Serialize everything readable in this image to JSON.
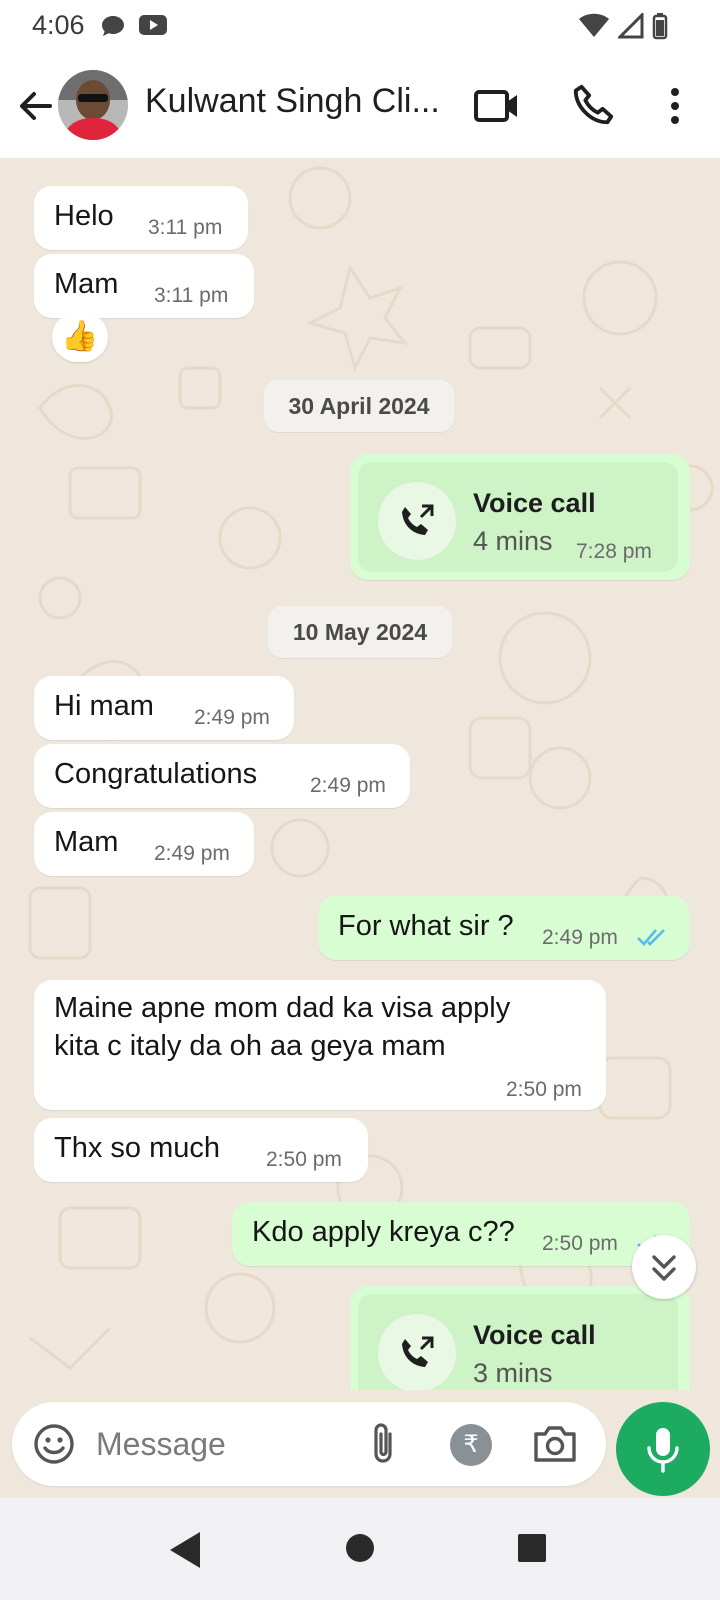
{
  "status_bar": {
    "time": "4:06"
  },
  "header": {
    "contact_name": "Kulwant Singh Cli..."
  },
  "messages": [
    {
      "text": "Helo",
      "time": "3:11 pm"
    },
    {
      "text": "Mam",
      "time": "3:11 pm"
    },
    {
      "reaction": "👍"
    },
    {
      "date": "30 April 2024"
    },
    {
      "call_title": "Voice call",
      "call_duration": "4 mins",
      "time": "7:28 pm"
    },
    {
      "date": "10 May 2024"
    },
    {
      "text": "Hi mam",
      "time": "2:49 pm"
    },
    {
      "text": "Congratulations",
      "time": "2:49 pm"
    },
    {
      "text": "Mam",
      "time": "2:49 pm"
    },
    {
      "text": "For what sir ?",
      "time": "2:49 pm"
    },
    {
      "text_line1": "Maine apne mom dad ka visa apply",
      "text_line2": "kita c italy da oh aa geya mam",
      "time": "2:50 pm"
    },
    {
      "text": "Thx so much",
      "time": "2:50 pm"
    },
    {
      "text": "Kdo apply kreya c??",
      "time": "2:50 pm"
    },
    {
      "call_title": "Voice call",
      "call_duration": "3 mins"
    }
  ],
  "composer": {
    "placeholder": "Message",
    "rupee_symbol": "₹"
  },
  "colors": {
    "accent": "#1daa61",
    "outgoing_bubble": "#d9fdd3",
    "chat_bg": "#efe7dc",
    "read_ticks": "#53bdeb"
  }
}
